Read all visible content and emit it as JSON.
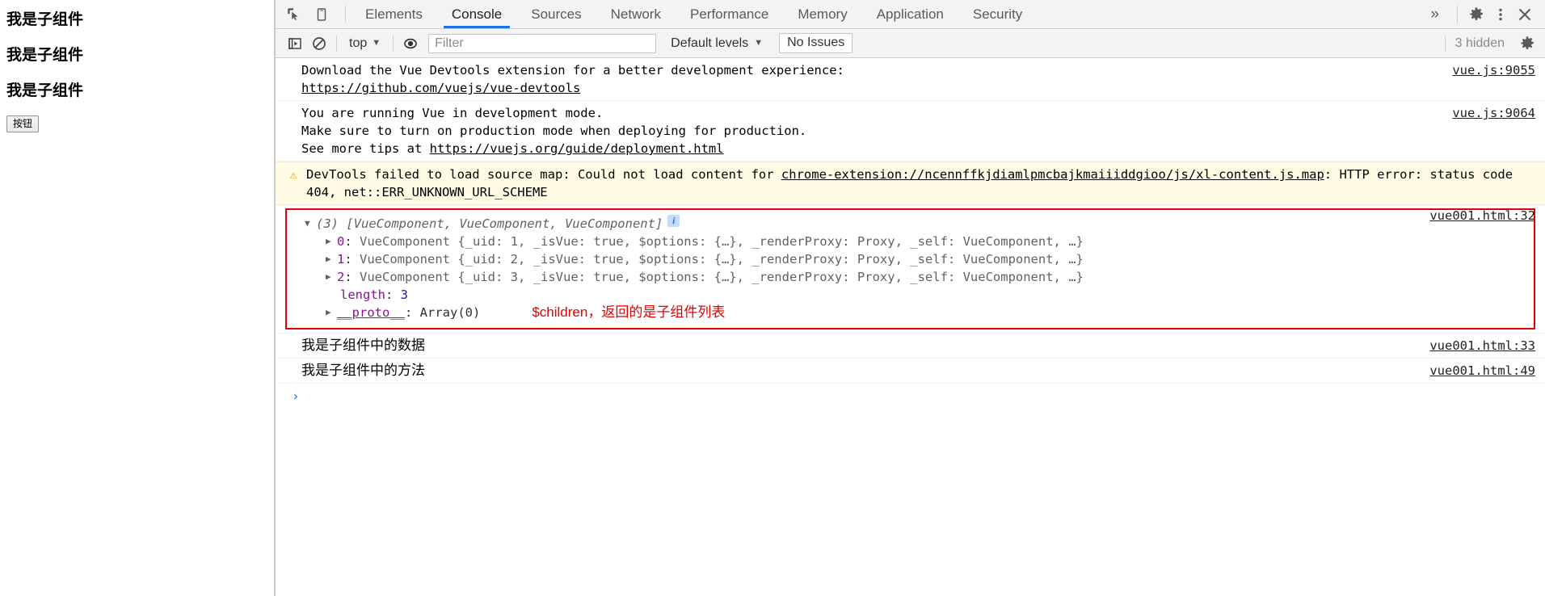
{
  "page_preview": {
    "headings": [
      "我是子组件",
      "我是子组件",
      "我是子组件"
    ],
    "button_label": "按钮"
  },
  "devtools": {
    "tabs": [
      {
        "label": "Elements",
        "active": false
      },
      {
        "label": "Console",
        "active": true
      },
      {
        "label": "Sources",
        "active": false
      },
      {
        "label": "Network",
        "active": false
      },
      {
        "label": "Performance",
        "active": false
      },
      {
        "label": "Memory",
        "active": false
      },
      {
        "label": "Application",
        "active": false
      },
      {
        "label": "Security",
        "active": false
      }
    ],
    "more_tabs_label": "»",
    "icons": {
      "inspect": "inspect-element-icon",
      "device": "device-toolbar-icon",
      "settings": "gear-icon",
      "kebab": "more-options-icon",
      "close": "close-icon"
    },
    "filterbar": {
      "sidebar_toggle": "console-sidebar-icon",
      "clear_console": "clear-console-icon",
      "context_label": "top",
      "context_caret": "▼",
      "live_expression": "eye-icon",
      "filter_placeholder": "Filter",
      "filter_value": "",
      "levels_label": "Default levels",
      "levels_caret": "▼",
      "issues_label": "No Issues",
      "hidden_label": "3 hidden",
      "settings_icon": "gear-icon"
    },
    "messages": [
      {
        "type": "log",
        "lines": [
          "Download the Vue Devtools extension for a better development experience:",
          "https://github.com/vuejs/vue-devtools"
        ],
        "link_text": "https://github.com/vuejs/vue-devtools",
        "source": "vue.js:9055"
      },
      {
        "type": "log",
        "lines": [
          "You are running Vue in development mode.",
          "Make sure to turn on production mode when deploying for production.",
          "See more tips at https://vuejs.org/guide/deployment.html"
        ],
        "prefix": "See more tips at ",
        "link_text": "https://vuejs.org/guide/deployment.html",
        "source": "vue.js:9064"
      },
      {
        "type": "warning",
        "icon": "warning-triangle-icon",
        "text_before_link": "DevTools failed to load source map: Could not load content for ",
        "link_text": "chrome-extension://ncennffkjdiamlpmcbajkmaiiiddgioo/js/xl-content.js.map",
        "text_after_link": ": HTTP error: status code 404, net::ERR_UNKNOWN_URL_SCHEME",
        "source": ""
      }
    ],
    "object_group": {
      "source": "vue001.html:32",
      "header": {
        "triangle": "▼",
        "count": "(3)",
        "summary": "[VueComponent, VueComponent, VueComponent]",
        "info_badge": "i"
      },
      "items": [
        {
          "index": "0",
          "ctor": "VueComponent",
          "preview": "{_uid: 1, _isVue: true, $options: {…}, _renderProxy: Proxy, _self: VueComponent, …}",
          "uid": "1"
        },
        {
          "index": "1",
          "ctor": "VueComponent",
          "preview": "{_uid: 2, _isVue: true, $options: {…}, _renderProxy: Proxy, _self: VueComponent, …}",
          "uid": "2"
        },
        {
          "index": "2",
          "ctor": "VueComponent",
          "preview": "{_uid: 3, _isVue: true, $options: {…}, _renderProxy: Proxy, _self: VueComponent, …}",
          "uid": "3"
        }
      ],
      "length_label": "length",
      "length_value": "3",
      "proto_label": "__proto__",
      "proto_value": "Array(0)",
      "annotation": "$children，返回的是子组件列表"
    },
    "log_rows": [
      {
        "text": "我是子组件中的数据",
        "source": "vue001.html:33"
      },
      {
        "text": "我是子组件中的方法",
        "source": "vue001.html:49"
      }
    ],
    "prompt_caret": "›"
  },
  "colors": {
    "accent_blue": "#1a73e8",
    "annotation_red": "#e00000",
    "warning_bg": "#fffbe5",
    "property_purple": "#881391",
    "value_blue": "#1a1aa6"
  }
}
